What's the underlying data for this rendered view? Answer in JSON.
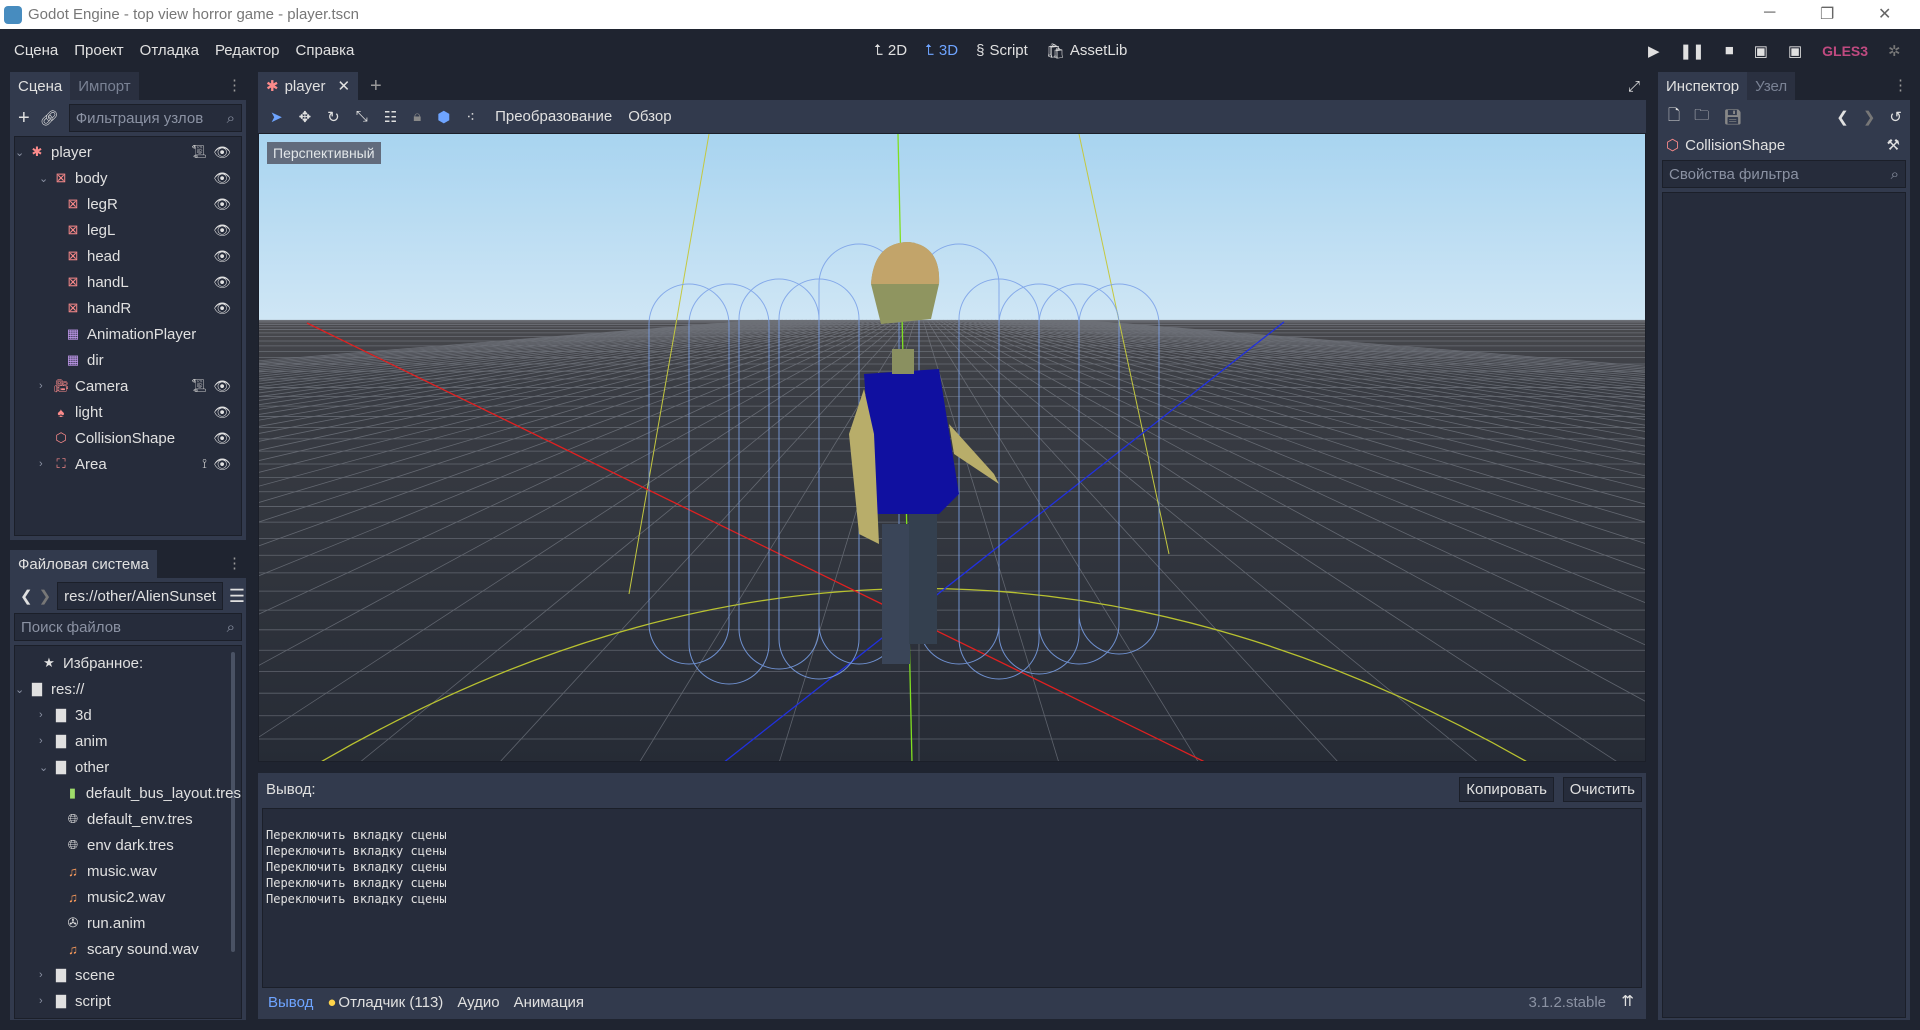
{
  "window": {
    "title": "Godot Engine - top view horror game - player.tscn",
    "minimize": "─",
    "restore": "❐",
    "close": "✕"
  },
  "menu": [
    "Сцена",
    "Проект",
    "Отладка",
    "Редактор",
    "Справка"
  ],
  "workspaces": [
    {
      "label": "2D",
      "icon": "2d-icon"
    },
    {
      "label": "3D",
      "icon": "3d-icon",
      "active": true
    },
    {
      "label": "Script",
      "icon": "script-icon"
    },
    {
      "label": "AssetLib",
      "icon": "assetlib-icon"
    }
  ],
  "run": {
    "renderer": "GLES3"
  },
  "scene_dock": {
    "tabs": [
      "Сцена",
      "Импорт"
    ],
    "filter_placeholder": "Фильтрация узлов",
    "nodes": [
      {
        "name": "player",
        "depth": 0,
        "expanded": true,
        "icon": "kinematic-body-icon",
        "script": true,
        "visible": true
      },
      {
        "name": "body",
        "depth": 1,
        "expanded": true,
        "icon": "mesh-instance-icon",
        "visible": true
      },
      {
        "name": "legR",
        "depth": 2,
        "icon": "mesh-instance-icon",
        "visible": true
      },
      {
        "name": "legL",
        "depth": 2,
        "icon": "mesh-instance-icon",
        "visible": true
      },
      {
        "name": "head",
        "depth": 2,
        "icon": "mesh-instance-icon",
        "visible": true
      },
      {
        "name": "handL",
        "depth": 2,
        "icon": "mesh-instance-icon",
        "visible": true
      },
      {
        "name": "handR",
        "depth": 2,
        "icon": "mesh-instance-icon",
        "visible": true
      },
      {
        "name": "AnimationPlayer",
        "depth": 2,
        "icon": "animation-player-icon"
      },
      {
        "name": "dir",
        "depth": 2,
        "icon": "animation-player-icon"
      },
      {
        "name": "Camera",
        "depth": 1,
        "collapsed": true,
        "icon": "camera-icon",
        "script": true,
        "visible": true
      },
      {
        "name": "light",
        "depth": 1,
        "icon": "light-icon",
        "visible": true
      },
      {
        "name": "CollisionShape",
        "depth": 1,
        "icon": "collision-shape-icon",
        "visible": true
      },
      {
        "name": "Area",
        "depth": 1,
        "collapsed": true,
        "icon": "area-icon",
        "signals": true,
        "visible": true
      }
    ]
  },
  "fs_dock": {
    "tab": "Файловая система",
    "path": "res://other/AlienSunset",
    "search_placeholder": "Поиск файлов",
    "items": [
      {
        "name": "Избранное:",
        "depth": 0,
        "icon": "star-icon"
      },
      {
        "name": "res://",
        "depth": 0,
        "expanded": true,
        "icon": "folder-icon"
      },
      {
        "name": "3d",
        "depth": 1,
        "collapsed": true,
        "icon": "folder-icon"
      },
      {
        "name": "anim",
        "depth": 1,
        "collapsed": true,
        "icon": "folder-icon"
      },
      {
        "name": "other",
        "depth": 1,
        "expanded": true,
        "icon": "folder-icon"
      },
      {
        "name": "default_bus_layout.tres",
        "depth": 2,
        "icon": "audio-bus-icon"
      },
      {
        "name": "default_env.tres",
        "depth": 2,
        "icon": "environment-icon"
      },
      {
        "name": "env dark.tres",
        "depth": 2,
        "icon": "environment-icon"
      },
      {
        "name": "music.wav",
        "depth": 2,
        "icon": "audio-icon"
      },
      {
        "name": "music2.wav",
        "depth": 2,
        "icon": "audio-icon"
      },
      {
        "name": "run.anim",
        "depth": 2,
        "icon": "animation-icon"
      },
      {
        "name": "scary sound.wav",
        "depth": 2,
        "icon": "audio-icon"
      },
      {
        "name": "scene",
        "depth": 1,
        "collapsed": true,
        "icon": "folder-icon"
      },
      {
        "name": "script",
        "depth": 1,
        "collapsed": true,
        "icon": "folder-icon"
      }
    ]
  },
  "editor": {
    "scene_tab": "player",
    "toolbar": {
      "transform": "Преобразование",
      "view": "Обзор"
    },
    "viewport_label": "Перспективный"
  },
  "output": {
    "title": "Вывод:",
    "copy": "Копировать",
    "clear": "Очистить",
    "lines": [
      "Переключить вкладку сцены",
      "Переключить вкладку сцены",
      "Переключить вкладку сцены",
      "Переключить вкладку сцены",
      "Переключить вкладку сцены"
    ],
    "bottom_tabs": [
      "Вывод",
      "Отладчик (113)",
      "Аудио",
      "Анимация"
    ],
    "version": "3.1.2.stable"
  },
  "inspector": {
    "tabs": [
      "Инспектор",
      "Узел"
    ],
    "node": "CollisionShape",
    "filter_placeholder": "Свойства фильтра"
  },
  "colors": {
    "accent": "#6ea4ff",
    "node_red": "#fc8b8b",
    "anim_purple": "#c49bf0",
    "gles": "#c04a80",
    "warn_dot": "#ffd44a"
  }
}
